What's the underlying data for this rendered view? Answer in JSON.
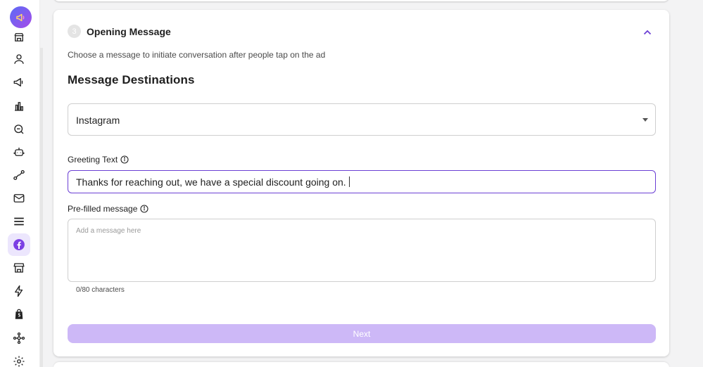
{
  "sidebar": {
    "logo_icon": "megaphone-logo-icon",
    "items": [
      {
        "name": "sidebar-item-store",
        "icon": "shop-icon"
      },
      {
        "name": "sidebar-item-contacts",
        "icon": "user-icon"
      },
      {
        "name": "sidebar-item-campaigns",
        "icon": "megaphone-icon"
      },
      {
        "name": "sidebar-item-analytics",
        "icon": "bar-chart-icon"
      },
      {
        "name": "sidebar-item-inbox",
        "icon": "chat-bubble-icon"
      },
      {
        "name": "sidebar-item-bots",
        "icon": "robot-icon"
      },
      {
        "name": "sidebar-item-flows",
        "icon": "flow-icon"
      },
      {
        "name": "sidebar-item-email",
        "icon": "mail-icon"
      },
      {
        "name": "sidebar-item-forms",
        "icon": "list-icon"
      },
      {
        "name": "sidebar-item-facebook",
        "icon": "facebook-icon",
        "active": true
      },
      {
        "name": "sidebar-item-storefront",
        "icon": "storefront-icon"
      },
      {
        "name": "sidebar-item-automations",
        "icon": "lightning-icon"
      },
      {
        "name": "sidebar-item-shopify",
        "icon": "shopify-bag-icon"
      },
      {
        "name": "sidebar-item-integrations",
        "icon": "network-icon"
      },
      {
        "name": "sidebar-item-settings",
        "icon": "gear-icon"
      }
    ]
  },
  "step": {
    "number": "3",
    "title": "Opening Message",
    "description": "Choose a message to initiate conversation after people tap on the ad"
  },
  "destinations": {
    "heading": "Message Destinations",
    "selected": "Instagram"
  },
  "greeting": {
    "label": "Greeting Text",
    "value": "Thanks for reaching out, we have a special discount going on."
  },
  "prefilled": {
    "label": "Pre-filled message",
    "placeholder": "Add a message here",
    "char_count": "0/80 characters"
  },
  "actions": {
    "next_label": "Next"
  },
  "colors": {
    "accent": "#6b3fd4",
    "button_disabled": "#cdb8f7",
    "active_nav_bg": "#ece6fd"
  }
}
